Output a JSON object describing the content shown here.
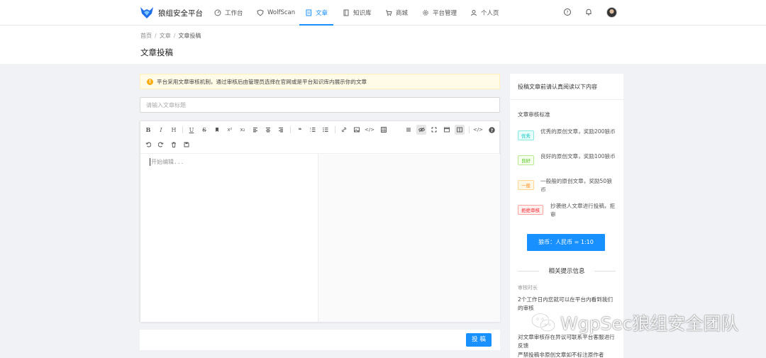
{
  "brand": {
    "name": "狼组安全平台"
  },
  "nav": [
    {
      "label": "工作台",
      "icon": "dashboard-icon"
    },
    {
      "label": "WolfScan",
      "icon": "shield-icon"
    },
    {
      "label": "文章",
      "icon": "article-icon",
      "active": true
    },
    {
      "label": "知识库",
      "icon": "book-icon"
    },
    {
      "label": "商城",
      "icon": "cart-icon"
    },
    {
      "label": "平台管理",
      "icon": "gear-icon"
    },
    {
      "label": "个人页",
      "icon": "user-icon"
    }
  ],
  "header": {
    "breadcrumb": [
      "首页",
      "文章",
      "文章投稿"
    ],
    "title": "文章投稿"
  },
  "notice": "平台采用文章审核机制，通过审核后由管理员选择在官网或是平台知识库内展示你的文章",
  "form": {
    "title_placeholder": "请输入文章标题",
    "editor_placeholder": "开始编辑...",
    "submit_label": "投 稿"
  },
  "sidebar": {
    "heading": "投稿文章前请认真阅读以下内容",
    "subheading": "文章审核标准",
    "rules": [
      {
        "tag": "优秀",
        "text": "优秀的原创文章，奖励200狼币",
        "color": "#13c2c2",
        "bg": "#e6fffb"
      },
      {
        "tag": "良好",
        "text": "良好的原创文章，奖励100狼币",
        "color": "#52c41a",
        "bg": "#f6ffed"
      },
      {
        "tag": "一般",
        "text": "一般般的原创文章，奖励50狼币",
        "color": "#fa8c16",
        "bg": "#fff7e6"
      },
      {
        "tag": "拒绝审核",
        "text": "抄袭他人文章进行投稿，拒审",
        "color": "#f5222d",
        "bg": "#fff1f0"
      }
    ],
    "rate_button": "狼币：人民币 = 1:10",
    "hint_title": "相关提示信息",
    "hints": [
      {
        "label": "审核时长",
        "text": "2个工作日内您就可以在平台内看到我们的审核"
      },
      {
        "label": "",
        "text": "对文章审核存在异议可联系平台客服进行反馈"
      },
      {
        "label": "",
        "text": "严禁投稿非原创文章如不标注原作者"
      }
    ]
  },
  "watermark": "WgpSec狼组安全团队",
  "colors": {
    "accent": "#1890ff",
    "warning": "#faad14"
  }
}
